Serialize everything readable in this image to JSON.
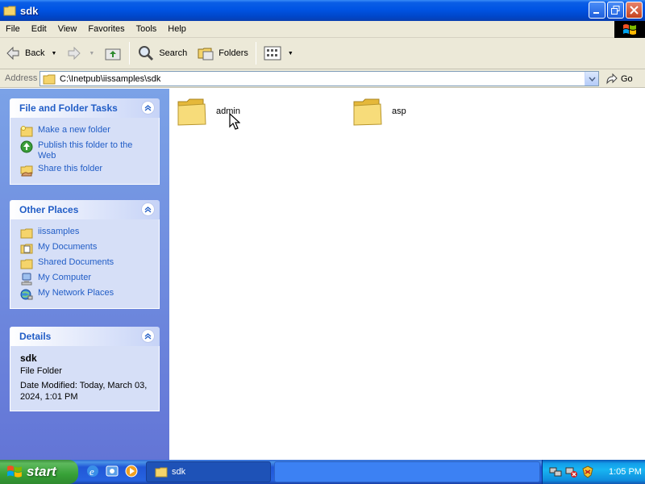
{
  "window": {
    "title": "sdk"
  },
  "menu": [
    "File",
    "Edit",
    "View",
    "Favorites",
    "Tools",
    "Help"
  ],
  "toolbar": {
    "back": "Back",
    "search": "Search",
    "folders": "Folders"
  },
  "address": {
    "label": "Address",
    "path": "C:\\Inetpub\\iissamples\\sdk",
    "go": "Go"
  },
  "panels": {
    "tasks": {
      "title": "File and Folder Tasks",
      "items": [
        "Make a new folder",
        "Publish this folder to the Web",
        "Share this folder"
      ]
    },
    "places": {
      "title": "Other Places",
      "items": [
        "iissamples",
        "My Documents",
        "Shared Documents",
        "My Computer",
        "My Network Places"
      ]
    },
    "details": {
      "title": "Details",
      "name": "sdk",
      "type": "File Folder",
      "modified": "Date Modified: Today, March 03, 2024, 1:01 PM"
    }
  },
  "files": [
    "admin",
    "asp"
  ],
  "taskbar": {
    "start": "start",
    "window_button": "sdk",
    "clock": "1:05 PM"
  },
  "colors": {
    "titlebar": "#0054e3",
    "link": "#215dc6",
    "panel_bg": "#d6dff7",
    "folder": "#f5d46b"
  }
}
